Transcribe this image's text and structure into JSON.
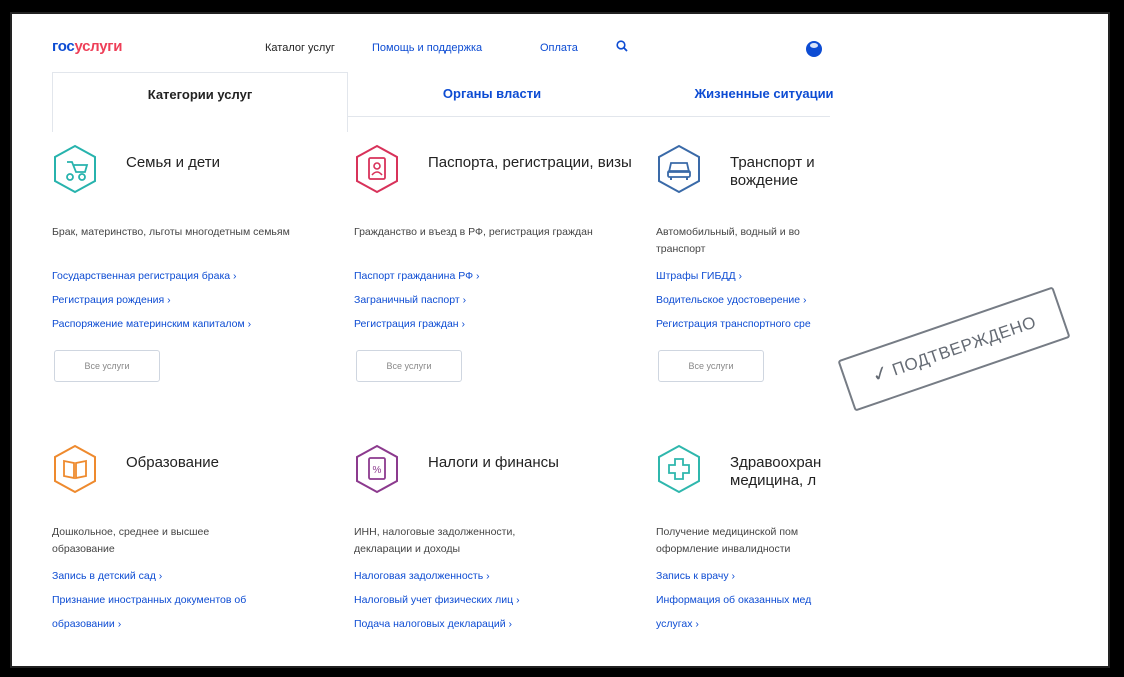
{
  "header": {
    "logo_part1": "гос",
    "logo_part2": "услуги",
    "nav_catalog": "Каталог услуг",
    "nav_help": "Помощь и поддержка",
    "nav_pay": "Оплата"
  },
  "tabs": [
    {
      "label": "Категории услуг"
    },
    {
      "label": "Органы власти"
    },
    {
      "label": "Жизненные ситуации"
    }
  ],
  "colors": {
    "brand_blue": "#0d4cd3",
    "brand_red": "#ee3f58"
  },
  "categories": [
    {
      "icon": "stroller-icon",
      "color": "#27b3ad",
      "title": "Семья и дети",
      "desc": "Брак, материнство, льготы многодетным семьям",
      "links": [
        "Государственная регистрация брака ›",
        "Регистрация рождения ›",
        "Распоряжение материнским капиталом ›"
      ],
      "all": "Все услуги"
    },
    {
      "icon": "passport-icon",
      "color": "#d8325a",
      "title": "Паспорта, регистрации, визы",
      "desc": "Гражданство и въезд в РФ, регистрация граждан",
      "links": [
        "Паспорт гражданина РФ ›",
        "Заграничный паспорт ›",
        "Регистрация граждан ›"
      ],
      "all": "Все услуги"
    },
    {
      "icon": "car-icon",
      "color": "#3a6aa8",
      "title": "Транспорт и вождение",
      "desc": "Автомобильный, водный и во транспорт",
      "links": [
        "Штрафы ГИБДД ›",
        "Водительское удостоверение ›",
        "Регистрация транспортного сре"
      ],
      "all": "Все услуги"
    },
    {
      "icon": "book-icon",
      "color": "#ee8a2e",
      "title": "Образование",
      "desc": "Дошкольное, среднее и высшее образование",
      "links": [
        "Запись в детский сад ›",
        "Признание иностранных документов об",
        "образовании ›"
      ],
      "all": ""
    },
    {
      "icon": "tax-document-icon",
      "color": "#8c3a8e",
      "title": "Налоги и финансы",
      "desc": "ИНН, налоговые задолженности, декларации и доходы",
      "links": [
        "Налоговая задолженность ›",
        "Налоговый учет физических лиц ›",
        "Подача налоговых деклараций ›"
      ],
      "all": ""
    },
    {
      "icon": "medical-cross-icon",
      "color": "#2fb7ad",
      "title": "Здравоохран медицина, л",
      "desc": "Получение медицинской пом оформление инвалидности",
      "links": [
        "Запись к врачу ›",
        "Информация об оказанных мед",
        "услугах ›"
      ],
      "all": ""
    }
  ],
  "stamp": {
    "text": "ПОДТВЕРЖДЕНО",
    "check": "✓"
  }
}
